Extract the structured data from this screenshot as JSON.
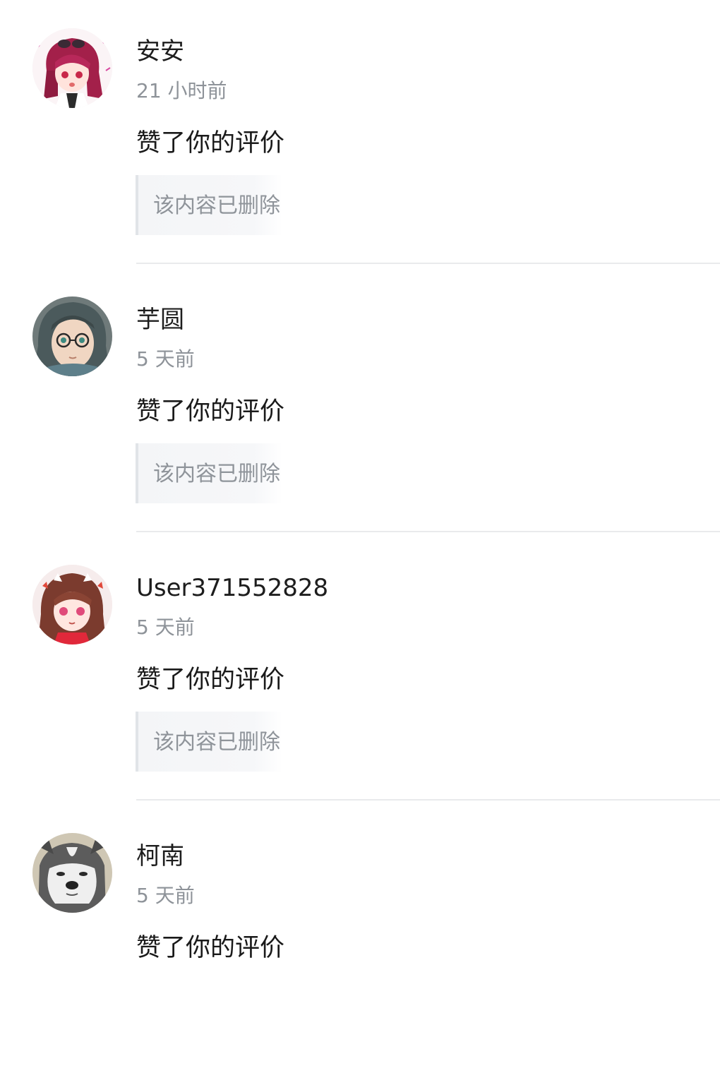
{
  "notifications": [
    {
      "username": "安安",
      "time": "21 小时前",
      "action": "赞了你的评价",
      "quoted": "该内容已删除",
      "avatar_desc": "anime-girl-red-hair-avatar"
    },
    {
      "username": "芋圆",
      "time": "5 天前",
      "action": "赞了你的评价",
      "quoted": "该内容已删除",
      "avatar_desc": "anime-girl-glasses-avatar"
    },
    {
      "username": "User371552828",
      "time": "5 天前",
      "action": "赞了你的评价",
      "quoted": "该内容已删除",
      "avatar_desc": "anime-girl-pink-avatar"
    },
    {
      "username": "柯南",
      "time": "5 天前",
      "action": "赞了你的评价",
      "avatar_desc": "husky-dog-avatar"
    }
  ],
  "colors": {
    "text_primary": "#1d1d1d",
    "text_secondary": "#8e9399",
    "quote_bg": "#f5f6f8",
    "quote_border": "#e1e4e8",
    "divider": "#e9eaec"
  }
}
